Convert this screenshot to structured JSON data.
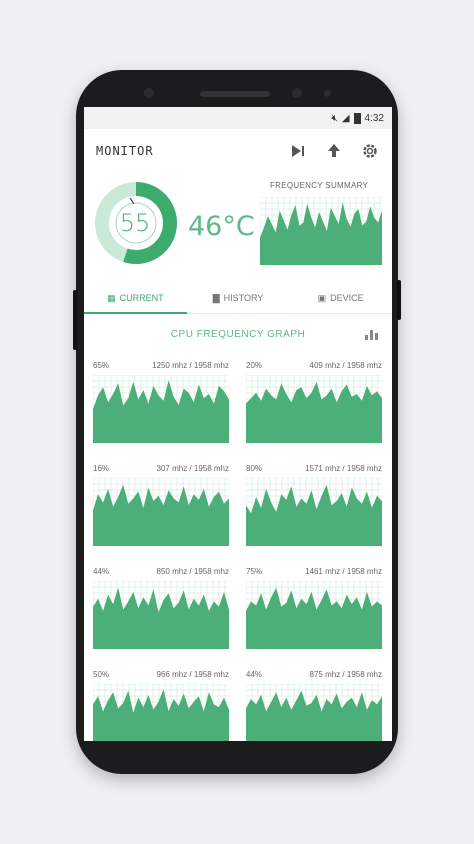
{
  "status": {
    "time": "4:32"
  },
  "app": {
    "title": "MONITOR"
  },
  "summary": {
    "load_percent": "55",
    "temperature": "46°C",
    "frequency_label": "FREQUENCY SUMMARY",
    "frequency_series": [
      40,
      55,
      72,
      60,
      48,
      80,
      66,
      52,
      74,
      88,
      58,
      62,
      90,
      70,
      55,
      78,
      64,
      50,
      84,
      72,
      60,
      92,
      68,
      56,
      76,
      82,
      58,
      64,
      86,
      70,
      62,
      80
    ]
  },
  "tabs": [
    {
      "label": "CURRENT",
      "icon": "memory-icon",
      "active": true
    },
    {
      "label": "HISTORY",
      "icon": "bar-chart-icon",
      "active": false
    },
    {
      "label": "DEVICE",
      "icon": "device-icon",
      "active": false
    }
  ],
  "graph_section": {
    "title": "CPU FREQUENCY GRAPH"
  },
  "cores": [
    {
      "percent": "65%",
      "freq": "1250 mhz / 1958 mhz",
      "series": [
        50,
        70,
        82,
        60,
        72,
        88,
        55,
        66,
        90,
        64,
        78,
        58,
        84,
        70,
        62,
        92,
        68,
        56,
        80,
        74,
        60,
        86,
        66,
        72,
        58,
        84,
        76,
        64
      ]
    },
    {
      "percent": "20%",
      "freq": "409 mhz / 1958 mhz",
      "series": [
        58,
        66,
        74,
        62,
        80,
        70,
        64,
        88,
        72,
        60,
        78,
        82,
        66,
        74,
        90,
        64,
        70,
        80,
        60,
        76,
        86,
        68,
        72,
        62,
        84,
        70,
        76,
        66
      ]
    },
    {
      "percent": "16%",
      "freq": "307 mhz / 1958 mhz",
      "series": [
        52,
        76,
        64,
        84,
        58,
        72,
        90,
        62,
        70,
        80,
        56,
        86,
        66,
        74,
        60,
        82,
        70,
        64,
        88,
        60,
        76,
        68,
        84,
        58,
        72,
        80,
        62,
        70
      ]
    },
    {
      "percent": "80%",
      "freq": "1571 mhz / 1958 mhz",
      "series": [
        60,
        48,
        72,
        56,
        84,
        64,
        50,
        76,
        68,
        88,
        58,
        70,
        62,
        82,
        54,
        74,
        90,
        60,
        66,
        78,
        58,
        86,
        70,
        62,
        80,
        56,
        74,
        66
      ]
    },
    {
      "percent": "44%",
      "freq": "850 mhz / 1958 mhz",
      "series": [
        62,
        74,
        56,
        80,
        66,
        90,
        58,
        70,
        84,
        60,
        76,
        64,
        88,
        54,
        72,
        82,
        60,
        68,
        86,
        58,
        74,
        64,
        80,
        56,
        70,
        62,
        84,
        58
      ]
    },
    {
      "percent": "75%",
      "freq": "1461 mhz / 1958 mhz",
      "series": [
        56,
        70,
        64,
        82,
        58,
        76,
        90,
        62,
        68,
        86,
        60,
        74,
        66,
        84,
        58,
        72,
        88,
        64,
        70,
        60,
        80,
        66,
        76,
        58,
        84,
        62,
        70,
        64
      ]
    },
    {
      "percent": "50%",
      "freq": "966 mhz / 1958 mhz",
      "series": [
        70,
        82,
        60,
        76,
        88,
        64,
        72,
        90,
        58,
        80,
        66,
        84,
        62,
        74,
        92,
        60,
        78,
        68,
        86,
        64,
        74,
        82,
        60,
        88,
        70,
        66,
        80,
        62
      ]
    },
    {
      "percent": "44%",
      "freq": "875 mhz / 1958 mhz",
      "series": [
        64,
        78,
        70,
        84,
        60,
        74,
        88,
        66,
        80,
        62,
        76,
        90,
        68,
        72,
        84,
        60,
        78,
        70,
        86,
        64,
        74,
        80,
        66,
        88,
        62,
        76,
        70,
        82
      ]
    }
  ],
  "colors": {
    "accent": "#3daa6e",
    "fill": "#4caf7a",
    "grid": "#dff0e6"
  }
}
